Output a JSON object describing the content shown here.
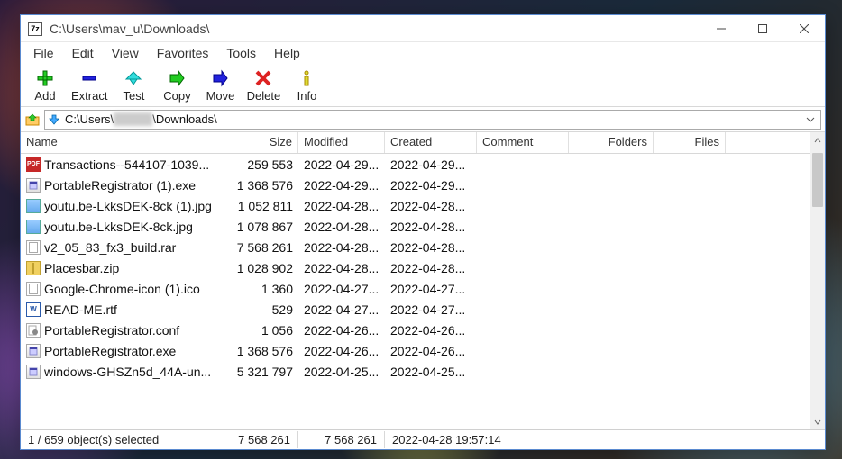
{
  "window": {
    "title": "C:\\Users\\mav_u\\Downloads\\"
  },
  "menu": {
    "file": "File",
    "edit": "Edit",
    "view": "View",
    "favorites": "Favorites",
    "tools": "Tools",
    "help": "Help"
  },
  "toolbar": {
    "add": "Add",
    "extract": "Extract",
    "test": "Test",
    "copy": "Copy",
    "move": "Move",
    "delete": "Delete",
    "info": "Info"
  },
  "address": {
    "path_prefix": "C:\\Users\\",
    "path_blur": "mav_u",
    "path_suffix": "\\Downloads\\"
  },
  "columns": {
    "name": "Name",
    "size": "Size",
    "modified": "Modified",
    "created": "Created",
    "comment": "Comment",
    "folders": "Folders",
    "files": "Files"
  },
  "files": [
    {
      "icon": "pdf",
      "name": "Transactions--544107-1039...",
      "size": "259 553",
      "modified": "2022-04-29...",
      "created": "2022-04-29..."
    },
    {
      "icon": "exe",
      "name": "PortableRegistrator (1).exe",
      "size": "1 368 576",
      "modified": "2022-04-29...",
      "created": "2022-04-29..."
    },
    {
      "icon": "img",
      "name": "youtu.be-LkksDEK-8ck (1).jpg",
      "size": "1 052 811",
      "modified": "2022-04-28...",
      "created": "2022-04-28..."
    },
    {
      "icon": "img",
      "name": "youtu.be-LkksDEK-8ck.jpg",
      "size": "1 078 867",
      "modified": "2022-04-28...",
      "created": "2022-04-28..."
    },
    {
      "icon": "doc",
      "name": "v2_05_83_fx3_build.rar",
      "size": "7 568 261",
      "modified": "2022-04-28...",
      "created": "2022-04-28..."
    },
    {
      "icon": "zip",
      "name": "Placesbar.zip",
      "size": "1 028 902",
      "modified": "2022-04-28...",
      "created": "2022-04-28..."
    },
    {
      "icon": "doc",
      "name": "Google-Chrome-icon (1).ico",
      "size": "1 360",
      "modified": "2022-04-27...",
      "created": "2022-04-27..."
    },
    {
      "icon": "rtf",
      "name": "READ-ME.rtf",
      "size": "529",
      "modified": "2022-04-27...",
      "created": "2022-04-27..."
    },
    {
      "icon": "conf",
      "name": "PortableRegistrator.conf",
      "size": "1 056",
      "modified": "2022-04-26...",
      "created": "2022-04-26..."
    },
    {
      "icon": "exe",
      "name": "PortableRegistrator.exe",
      "size": "1 368 576",
      "modified": "2022-04-26...",
      "created": "2022-04-26..."
    },
    {
      "icon": "exe",
      "name": "windows-GHSZn5d_44A-un...",
      "size": "5 321 797",
      "modified": "2022-04-25...",
      "created": "2022-04-25..."
    }
  ],
  "status": {
    "selection": "1 / 659 object(s) selected",
    "size1": "7 568 261",
    "size2": "7 568 261",
    "date": "2022-04-28 19:57:14"
  }
}
